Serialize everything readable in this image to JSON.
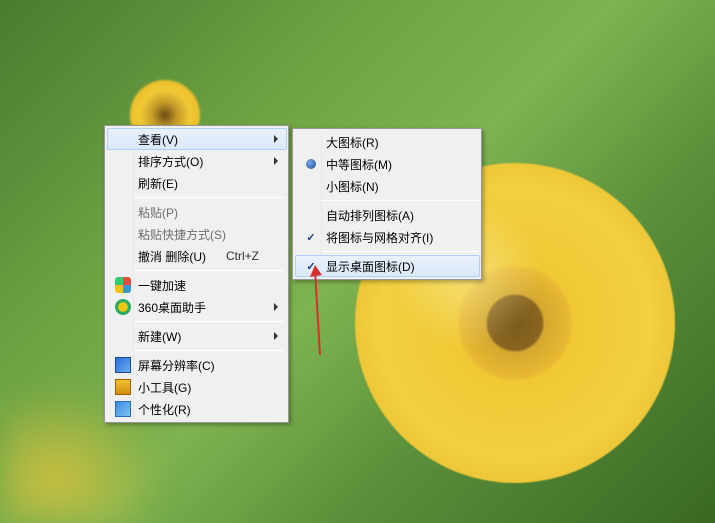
{
  "primaryMenu": {
    "view": {
      "label": "查看(V)"
    },
    "sort": {
      "label": "排序方式(O)"
    },
    "refresh": {
      "label": "刷新(E)"
    },
    "paste": {
      "label": "粘贴(P)"
    },
    "pasteShortcut": {
      "label": "粘贴快捷方式(S)"
    },
    "undoDelete": {
      "label": "撤消 删除(U)",
      "shortcut": "Ctrl+Z"
    },
    "accel": {
      "label": "一键加速"
    },
    "desk360": {
      "label": "360桌面助手"
    },
    "new": {
      "label": "新建(W)"
    },
    "resolution": {
      "label": "屏幕分辨率(C)"
    },
    "gadgets": {
      "label": "小工具(G)"
    },
    "personalize": {
      "label": "个性化(R)"
    }
  },
  "subMenu": {
    "largeIcons": {
      "label": "大图标(R)"
    },
    "mediumIcons": {
      "label": "中等图标(M)"
    },
    "smallIcons": {
      "label": "小图标(N)"
    },
    "autoArrange": {
      "label": "自动排列图标(A)"
    },
    "alignGrid": {
      "label": "将图标与网格对齐(I)"
    },
    "showIcons": {
      "label": "显示桌面图标(D)"
    }
  }
}
